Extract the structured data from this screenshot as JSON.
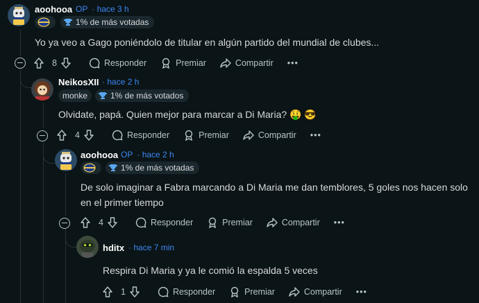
{
  "comments": [
    {
      "user": "aoohooa",
      "op": "OP",
      "time": "hace 3 h",
      "badge": "1% de más votadas",
      "body": "Yo ya veo a Gago poniéndolo de titular en algún partido del mundial de clubes...",
      "votes": "8"
    },
    {
      "user": "NeikosXII",
      "time": "hace 2 h",
      "flair": "monke",
      "badge": "1% de más votados",
      "body": "Olvidate, papá. Quien mejor para marcar a Di Maria? 🤑 😎",
      "votes": "4"
    },
    {
      "user": "aoohooa",
      "op": "OP",
      "time": "hace 2 h",
      "badge": "1% de más votadas",
      "body": "De solo imaginar a Fabra marcando a Di Maria me dan temblores, 5 goles nos hacen solo en el primer tiempo",
      "votes": "4"
    },
    {
      "user": "hditx",
      "time": "hace 7 min",
      "body": "Respira Di Maria y ya le comió la espalda 5 veces",
      "votes": "1"
    }
  ],
  "actions": {
    "reply": "Responder",
    "award": "Premiar",
    "share": "Compartir",
    "more": "•••"
  },
  "colors": {
    "background": "#0b1416",
    "meta": "#3d88f5",
    "text": "#d7dadc",
    "muted": "#b8c5c9"
  },
  "icons": [
    "upvote-icon",
    "downvote-icon",
    "comment-icon",
    "award-icon",
    "share-icon",
    "collapse-icon",
    "trophy-icon",
    "club-crest-icon"
  ]
}
